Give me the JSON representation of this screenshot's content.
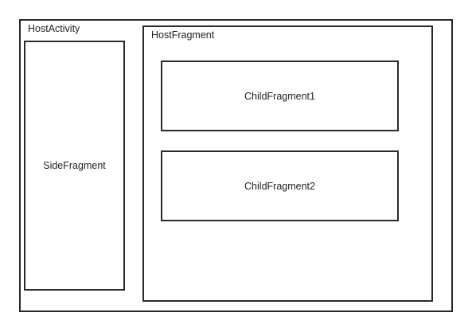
{
  "diagram": {
    "host_activity": {
      "label": "HostActivity"
    },
    "side_fragment": {
      "label": "SideFragment"
    },
    "host_fragment": {
      "label": "HostFragment"
    },
    "child_fragments": [
      {
        "label": "ChildFragment1"
      },
      {
        "label": "ChildFragment2"
      }
    ]
  }
}
